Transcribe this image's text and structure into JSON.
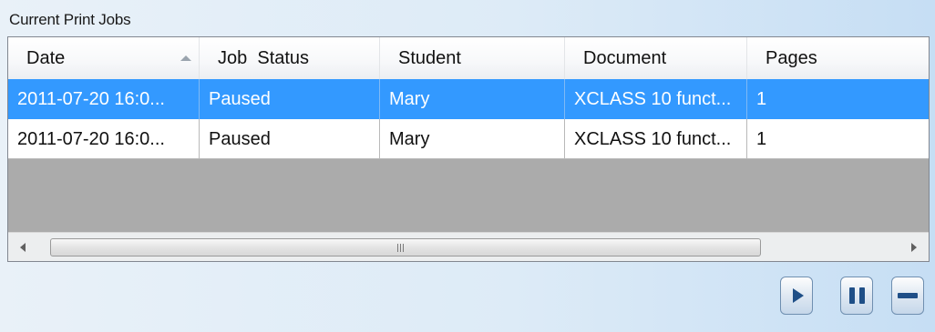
{
  "panel": {
    "title": "Current Print Jobs"
  },
  "grid": {
    "columns": [
      "Date",
      "Job  Status",
      "Student",
      "Document",
      "Pages"
    ],
    "sort": {
      "column": "Date",
      "direction": "ascending"
    },
    "rows": [
      {
        "date": "2011-07-20 16:0...",
        "status": "Paused",
        "student": "Mary",
        "document": "XCLASS 10 funct...",
        "pages": "1",
        "selected": true
      },
      {
        "date": "2011-07-20 16:0...",
        "status": "Paused",
        "student": "Mary",
        "document": "XCLASS 10 funct...",
        "pages": "1",
        "selected": false
      }
    ],
    "scroll_grip": "III"
  },
  "actions": {
    "resume": {
      "icon": "play-icon"
    },
    "pause": {
      "icon": "pause-icon"
    },
    "cancel": {
      "icon": "stop-icon"
    }
  },
  "colors": {
    "selection": "#3399ff",
    "button_icon": "#1f4f87",
    "grid_background": "#ababab"
  }
}
